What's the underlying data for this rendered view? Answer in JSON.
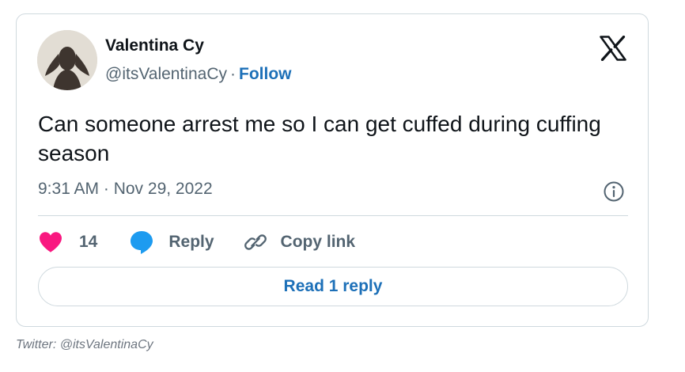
{
  "author": {
    "name": "Valentina Cy",
    "handle": "@itsValentinaCy",
    "separator": "·",
    "follow_label": "Follow",
    "avatar_icon": "avatar-silhouette"
  },
  "brand": {
    "logo_icon": "x-logo-icon"
  },
  "tweet": {
    "text": "Can someone arrest me so I can get cuffed during cuffing season",
    "timestamp": "9:31 AM · Nov 29, 2022"
  },
  "actions": {
    "like_count": "14",
    "reply_label": "Reply",
    "copy_label": "Copy link"
  },
  "read_replies_label": "Read 1 reply",
  "caption": "Twitter: @itsValentinaCy",
  "colors": {
    "heart": "#f91880",
    "reply_bubble": "#1d9bf0",
    "link": "#1d70b8",
    "muted": "#536471",
    "border": "#cfd9de"
  }
}
